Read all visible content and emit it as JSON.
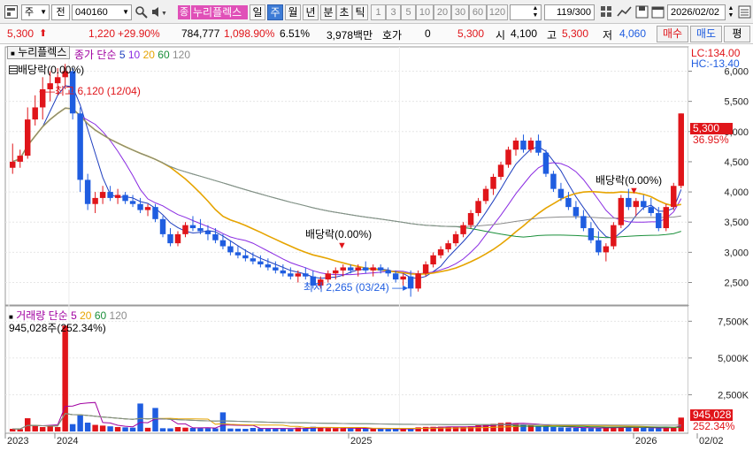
{
  "toolbar": {
    "market_label": "주",
    "type_label": "전",
    "code": "040160",
    "name": "누리플렉스",
    "name_badge": "종",
    "periods": [
      "일",
      "주",
      "월",
      "년"
    ],
    "intervals": [
      "분",
      "초",
      "틱"
    ],
    "numbers": [
      "1",
      "3",
      "5",
      "10",
      "20",
      "30",
      "60",
      "120"
    ],
    "count": "119",
    "count_total": "/300",
    "date": "2026/02/02"
  },
  "quote": {
    "price": "5,300",
    "change": "1,220",
    "change_pct": "+29.90%",
    "volume": "784,777",
    "volume_pct": "1,098.90%",
    "turnover_pct": "6.51%",
    "amount": "3,978백만",
    "hoga_label": "호가",
    "hoga_value": "0",
    "hoga_price": "5,300",
    "open_label": "시",
    "open": "4,100",
    "high_label": "고",
    "high": "5,300",
    "low_label": "저",
    "low": "4,060",
    "buy_label": "매수",
    "sell_label": "매도",
    "eval_label": "평"
  },
  "price_panel": {
    "name": "누리플렉스",
    "ma_title": "종가 단순",
    "ma_periods": [
      "5",
      "10",
      "20",
      "60",
      "120"
    ],
    "ma_colors": [
      "#1f3fbf",
      "#8a2be2",
      "#e6a400",
      "#1a8f3a",
      "#8c8c8c"
    ],
    "dividend_top": "배당락(0.00%)",
    "lc": "LC:134.00",
    "hc": "HC:-13.40",
    "high_label": "최고 6,120 (12/04)",
    "low_label": "최저 2,265 (03/24)",
    "div_mid": "배당락(0.00%)",
    "div_right": "배당락(0.00%)",
    "y_ticks": [
      "6,000",
      "5,500",
      "5,000",
      "4,500",
      "4,000",
      "3,500",
      "3,000",
      "2,500"
    ],
    "price_tag": "5,300",
    "pct_tag": "36.95%"
  },
  "volume_panel": {
    "title": "거래량 단순",
    "ma_periods": [
      "5",
      "20",
      "60",
      "120"
    ],
    "value": "945,028주(252.34%)",
    "y_ticks": [
      "7,500K",
      "5,000K",
      "2,500K"
    ],
    "vol_tag": "945,028",
    "vol_pct_tag": "252.34%"
  },
  "x_axis": {
    "labels": [
      "2023",
      "2024",
      "2025",
      "2026",
      "02/02"
    ]
  },
  "chart_data": {
    "type": "candlestick",
    "title": "누리플렉스 (040160) 주봉",
    "ylim": [
      2200,
      6300
    ],
    "candles": [
      [
        4400,
        4800,
        4300,
        4500
      ],
      [
        4500,
        4700,
        4400,
        4600
      ],
      [
        4600,
        5400,
        4550,
        5200
      ],
      [
        5200,
        5600,
        5100,
        5400
      ],
      [
        5400,
        5900,
        5200,
        5700
      ],
      [
        5700,
        6000,
        5500,
        5800
      ],
      [
        5800,
        6050,
        5600,
        5900
      ],
      [
        5900,
        6120,
        5700,
        6000
      ],
      [
        6000,
        6050,
        5200,
        5300
      ],
      [
        5300,
        5400,
        4000,
        4200
      ],
      [
        4200,
        4300,
        3700,
        3800
      ],
      [
        3800,
        4000,
        3650,
        3900
      ],
      [
        3900,
        4100,
        3800,
        4000
      ],
      [
        4000,
        4100,
        3850,
        3900
      ],
      [
        3900,
        4050,
        3800,
        3950
      ],
      [
        3950,
        4000,
        3800,
        3850
      ],
      [
        3850,
        3950,
        3750,
        3800
      ],
      [
        3800,
        3900,
        3650,
        3700
      ],
      [
        3700,
        3800,
        3600,
        3750
      ],
      [
        3750,
        3800,
        3500,
        3550
      ],
      [
        3550,
        3600,
        3250,
        3300
      ],
      [
        3300,
        3400,
        3100,
        3150
      ],
      [
        3150,
        3350,
        3100,
        3300
      ],
      [
        3300,
        3500,
        3250,
        3450
      ],
      [
        3450,
        3600,
        3350,
        3400
      ],
      [
        3400,
        3550,
        3300,
        3350
      ],
      [
        3350,
        3450,
        3200,
        3300
      ],
      [
        3300,
        3400,
        3150,
        3200
      ],
      [
        3200,
        3300,
        3050,
        3100
      ],
      [
        3100,
        3200,
        2950,
        3000
      ],
      [
        3000,
        3100,
        2900,
        2950
      ],
      [
        2950,
        3050,
        2850,
        2900
      ],
      [
        2900,
        3000,
        2800,
        2850
      ],
      [
        2850,
        2950,
        2750,
        2800
      ],
      [
        2800,
        2900,
        2700,
        2750
      ],
      [
        2750,
        2850,
        2650,
        2700
      ],
      [
        2700,
        2800,
        2600,
        2650
      ],
      [
        2650,
        2750,
        2550,
        2600
      ],
      [
        2600,
        2700,
        2500,
        2650
      ],
      [
        2650,
        2750,
        2550,
        2600
      ],
      [
        2600,
        2700,
        2400,
        2450
      ],
      [
        2450,
        2600,
        2400,
        2550
      ],
      [
        2550,
        2700,
        2500,
        2650
      ],
      [
        2650,
        2750,
        2550,
        2700
      ],
      [
        2700,
        2800,
        2600,
        2750
      ],
      [
        2750,
        2800,
        2650,
        2700
      ],
      [
        2700,
        2800,
        2600,
        2750
      ],
      [
        2750,
        2850,
        2650,
        2700
      ],
      [
        2700,
        2800,
        2600,
        2750
      ],
      [
        2750,
        2800,
        2650,
        2700
      ],
      [
        2700,
        2750,
        2600,
        2650
      ],
      [
        2650,
        2700,
        2500,
        2550
      ],
      [
        2550,
        2650,
        2450,
        2600
      ],
      [
        2600,
        2700,
        2265,
        2400
      ],
      [
        2400,
        2700,
        2350,
        2650
      ],
      [
        2650,
        2850,
        2600,
        2800
      ],
      [
        2800,
        3000,
        2750,
        2950
      ],
      [
        2950,
        3100,
        2900,
        3050
      ],
      [
        3050,
        3200,
        3000,
        3150
      ],
      [
        3150,
        3350,
        3100,
        3300
      ],
      [
        3300,
        3500,
        3250,
        3450
      ],
      [
        3450,
        3700,
        3400,
        3650
      ],
      [
        3650,
        3900,
        3600,
        3850
      ],
      [
        3850,
        4100,
        3800,
        4050
      ],
      [
        4050,
        4300,
        3950,
        4250
      ],
      [
        4250,
        4500,
        4200,
        4450
      ],
      [
        4450,
        4750,
        4400,
        4700
      ],
      [
        4700,
        4900,
        4600,
        4850
      ],
      [
        4850,
        4950,
        4650,
        4700
      ],
      [
        4700,
        4900,
        4650,
        4850
      ],
      [
        4850,
        4950,
        4600,
        4650
      ],
      [
        4650,
        4700,
        4250,
        4300
      ],
      [
        4300,
        4350,
        4000,
        4050
      ],
      [
        4050,
        4150,
        3850,
        3900
      ],
      [
        3900,
        4000,
        3700,
        3750
      ],
      [
        3750,
        3850,
        3550,
        3600
      ],
      [
        3600,
        3700,
        3350,
        3400
      ],
      [
        3400,
        3500,
        3150,
        3200
      ],
      [
        3200,
        3350,
        2950,
        3000
      ],
      [
        3000,
        3150,
        2850,
        3100
      ],
      [
        3100,
        3500,
        3050,
        3450
      ],
      [
        3450,
        3950,
        3400,
        3900
      ],
      [
        3900,
        4050,
        3700,
        3750
      ],
      [
        3750,
        3900,
        3600,
        3850
      ],
      [
        3850,
        3950,
        3700,
        3750
      ],
      [
        3750,
        3900,
        3600,
        3650
      ],
      [
        3650,
        3750,
        3350,
        3400
      ],
      [
        3400,
        3800,
        3350,
        3750
      ],
      [
        3750,
        4150,
        3700,
        4100
      ],
      [
        4100,
        5300,
        4060,
        5300
      ]
    ],
    "volume": {
      "values": [
        180,
        160,
        900,
        400,
        300,
        350,
        300,
        7200,
        500,
        1100,
        600,
        450,
        400,
        350,
        300,
        280,
        260,
        1900,
        250,
        1600,
        220,
        210,
        300,
        260,
        240,
        230,
        220,
        210,
        1300,
        200,
        190,
        180,
        240,
        210,
        200,
        190,
        180,
        170,
        260,
        230,
        320,
        250,
        230,
        220,
        210,
        200,
        210,
        220,
        190,
        180,
        170,
        180,
        160,
        200,
        280,
        310,
        320,
        330,
        310,
        300,
        320,
        360,
        420,
        460,
        520,
        580,
        620,
        560,
        480,
        420,
        380,
        330,
        300,
        280,
        260,
        250,
        240,
        230,
        220,
        260,
        310,
        300,
        270,
        250,
        240,
        230,
        220,
        260,
        300,
        945
      ],
      "ylim": [
        0,
        8000
      ],
      "unit": "K"
    }
  }
}
